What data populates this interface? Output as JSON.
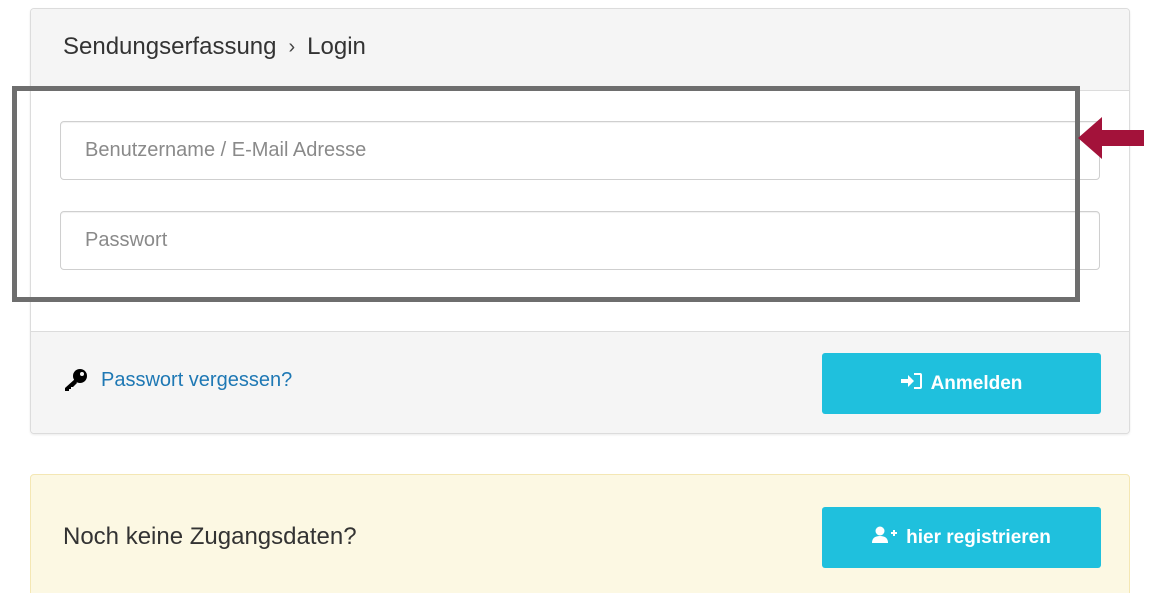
{
  "header": {
    "breadcrumb_section": "Sendungserfassung",
    "breadcrumb_separator": "›",
    "breadcrumb_current": "Login"
  },
  "form": {
    "username_placeholder": "Benutzername / E-Mail Adresse",
    "username_value": "",
    "password_placeholder": "Passwort",
    "password_value": ""
  },
  "footer": {
    "forgot_label": "Passwort vergessen?",
    "login_label": "Anmelden"
  },
  "registration": {
    "prompt": "Noch keine Zugangsdaten?",
    "register_label": "hier registrieren"
  },
  "colors": {
    "accent": "#1fc0dd",
    "link": "#1e78b4",
    "annotation_box": "#6e6e6e",
    "annotation_arrow": "#a3123a",
    "reg_background": "#fcf8e3"
  },
  "icons": {
    "forgot": "key-icon",
    "login": "sign-in-icon",
    "register": "user-plus-icon",
    "annotation": "arrow-left-icon"
  }
}
